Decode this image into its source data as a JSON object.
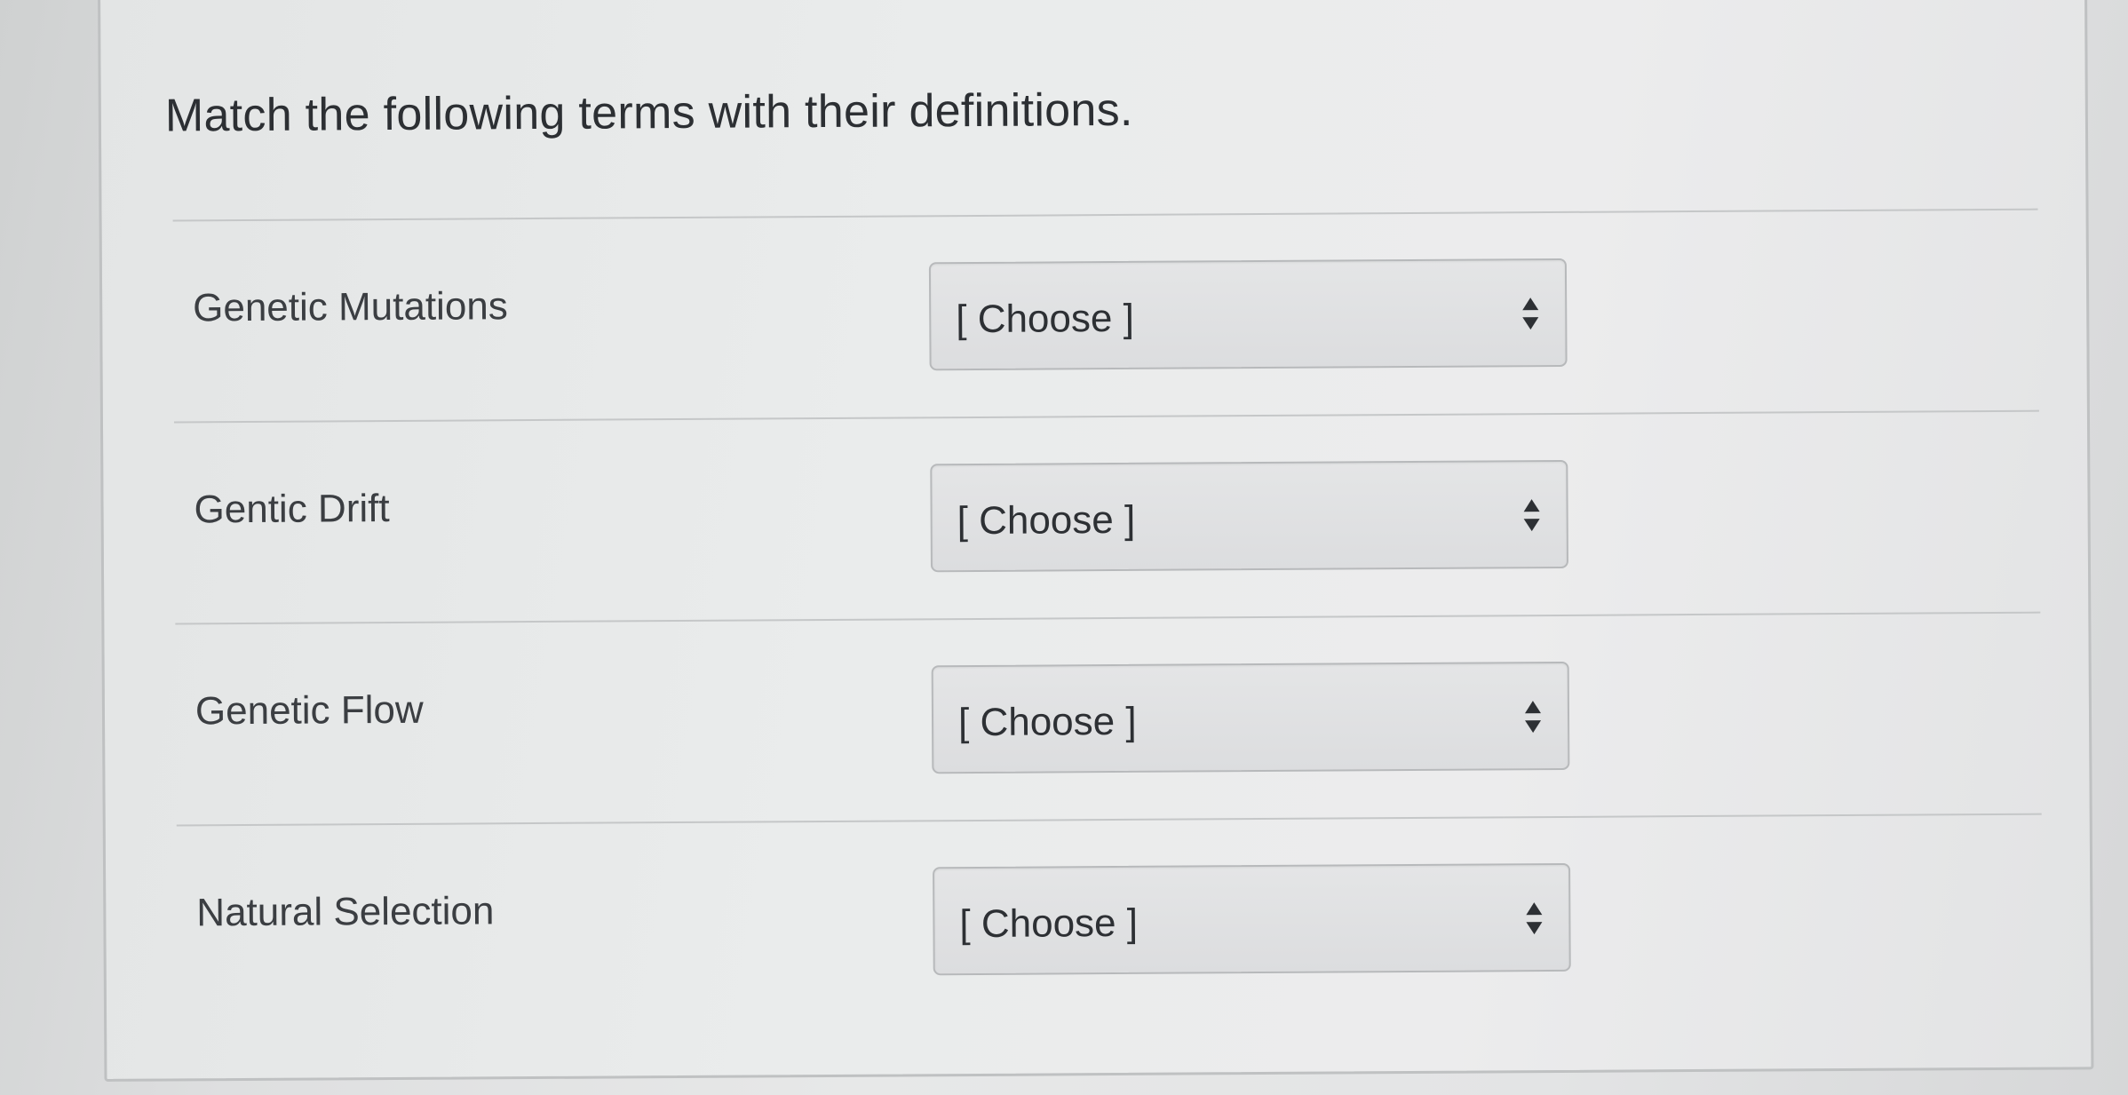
{
  "question": {
    "prompt": "Match the following terms with their definitions."
  },
  "rows": [
    {
      "term": "Genetic Mutations",
      "select_value": "[ Choose ]"
    },
    {
      "term": "Gentic Drift",
      "select_value": "[ Choose ]"
    },
    {
      "term": "Genetic Flow",
      "select_value": "[ Choose ]"
    },
    {
      "term": "Natural Selection",
      "select_value": "[ Choose ]"
    }
  ],
  "icons": {
    "select_arrow": "up-down-arrows-icon"
  },
  "colors": {
    "text": "#2c2f33",
    "select_bg": "#dedfe0",
    "border": "#b7b9bb"
  }
}
